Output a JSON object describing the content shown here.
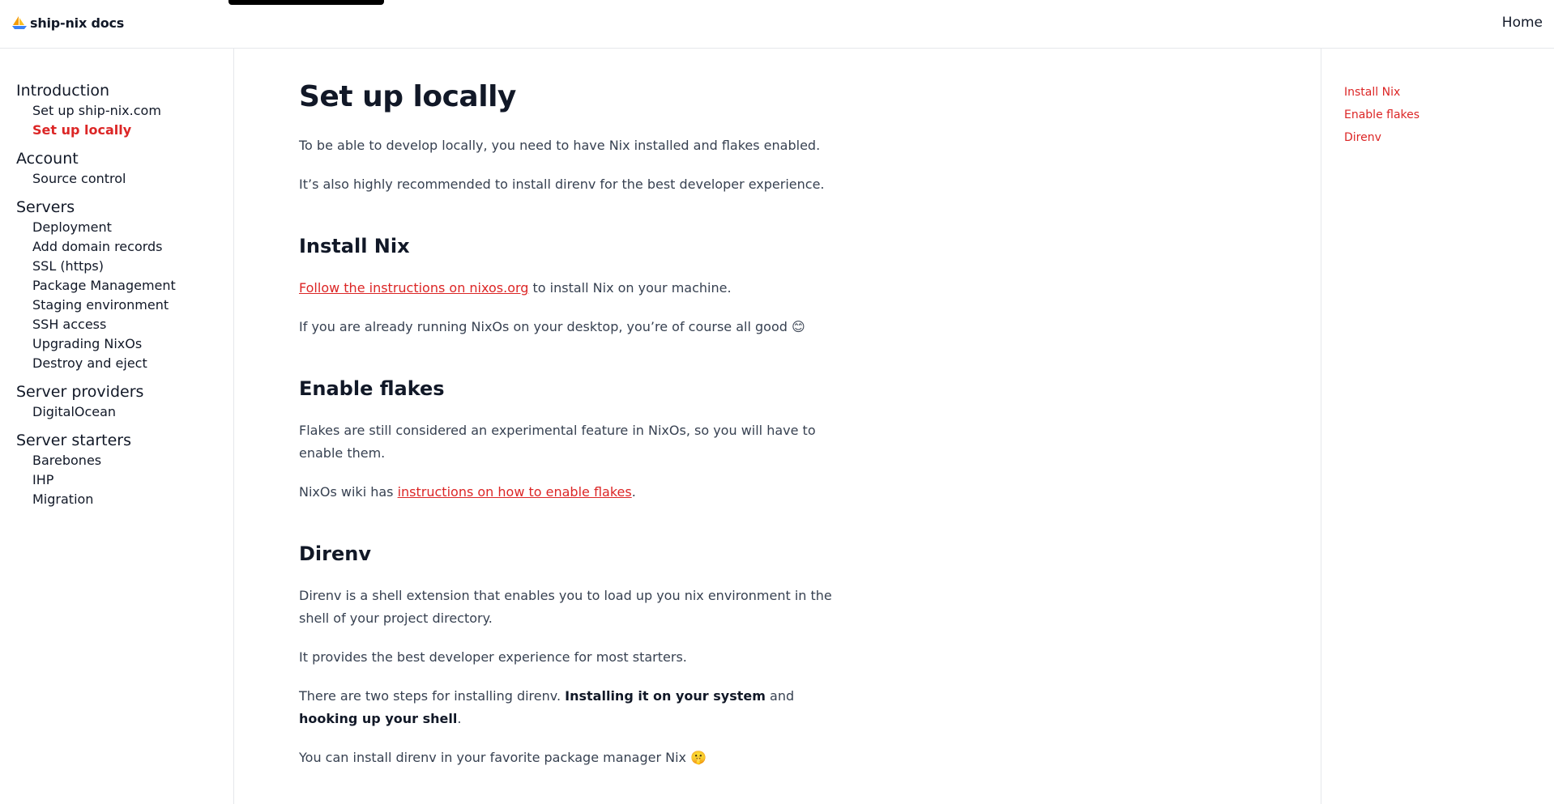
{
  "header": {
    "brand": "ship-nix docs",
    "brand_icon": "sailboat-icon",
    "home_label": "Home"
  },
  "sidebar": {
    "sections": [
      {
        "title": "Introduction",
        "items": [
          "Set up ship-nix.com",
          "Set up locally"
        ],
        "active": 1
      },
      {
        "title": "Account",
        "items": [
          "Source control"
        ]
      },
      {
        "title": "Servers",
        "items": [
          "Deployment",
          "Add domain records",
          "SSL (https)",
          "Package Management",
          "Staging environment",
          "SSH access",
          "Upgrading NixOs",
          "Destroy and eject"
        ]
      },
      {
        "title": "Server providers",
        "items": [
          "DigitalOcean"
        ]
      },
      {
        "title": "Server starters",
        "items": [
          "Barebones",
          "IHP",
          "Migration"
        ]
      }
    ]
  },
  "main": {
    "title": "Set up locally",
    "intro_1": "To be able to develop locally, you need to have Nix installed and flakes enabled.",
    "intro_2": "It’s also highly recommended to install direnv for the best developer experience.",
    "install_nix": {
      "heading": "Install Nix",
      "link_text": "Follow the instructions on nixos.org",
      "after_link": " to install Nix on your machine.",
      "para_2": "If you are already running NixOs on your desktop, you’re of course all good 😊"
    },
    "enable_flakes": {
      "heading": "Enable flakes",
      "para_1": "Flakes are still considered an experimental feature in NixOs, so you will have to enable them.",
      "wiki_before": "NixOs wiki has ",
      "wiki_link": "instructions on how to enable flakes",
      "wiki_after": "."
    },
    "direnv": {
      "heading": "Direnv",
      "para_1": "Direnv is a shell extension that enables you to load up you nix environment in the shell of your project directory.",
      "para_2": "It provides the best developer experience for most starters.",
      "steps_before": "There are two steps for installing direnv. ",
      "steps_bold_1": "Installing it on your system",
      "steps_mid": " and ",
      "steps_bold_2": "hooking up your shell",
      "steps_after": ".",
      "para_4": "You can install direnv in your favorite package manager Nix 🤫"
    }
  },
  "toc": {
    "items": [
      "Install Nix",
      "Enable flakes",
      "Direnv"
    ]
  },
  "colors": {
    "accent": "#dc2626",
    "text": "#111827",
    "body_text": "#374151",
    "border": "#e5e7eb"
  }
}
